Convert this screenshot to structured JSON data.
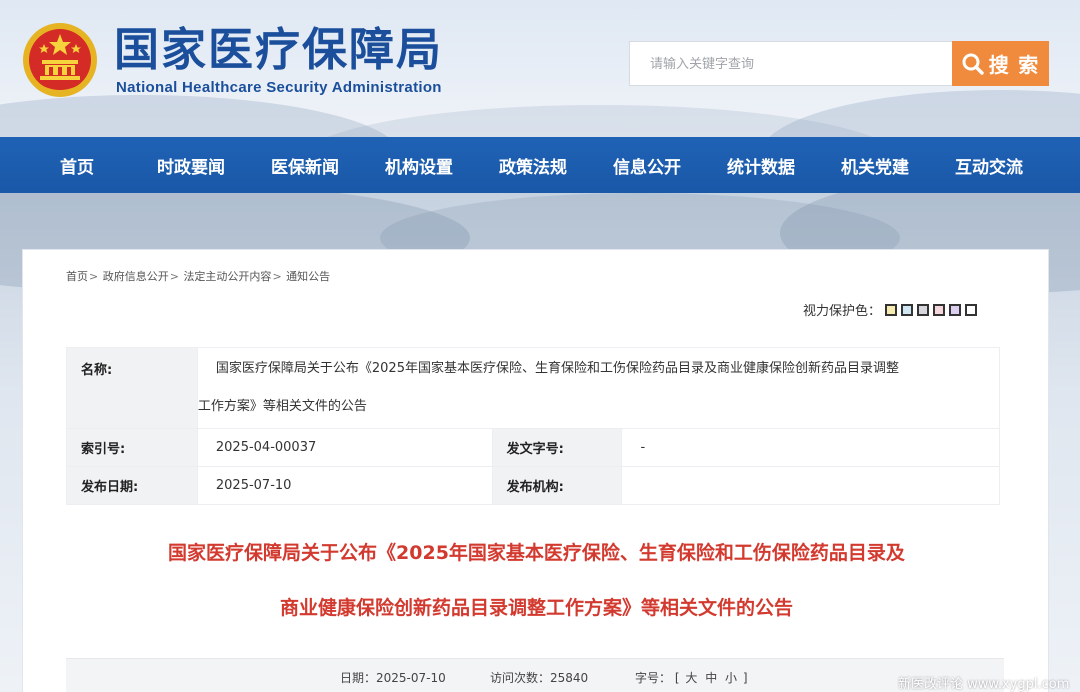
{
  "header": {
    "title_cn": "国家医疗保障局",
    "title_en": "National Healthcare Security Administration",
    "search_placeholder": "请输入关键字查询",
    "search_button": "搜 索"
  },
  "nav": {
    "items": [
      "首页",
      "时政要闻",
      "医保新闻",
      "机构设置",
      "政策法规",
      "信息公开",
      "统计数据",
      "机关党建",
      "互动交流"
    ]
  },
  "breadcrumb": {
    "items": [
      "首页",
      "政府信息公开",
      "法定主动公开内容",
      "通知公告"
    ],
    "separator": ">"
  },
  "vision": {
    "label": "视力保护色：",
    "swatches": [
      "#f6ecb0",
      "#cfe7f2",
      "#d6d6dc",
      "#f4d6dc",
      "#dccff0",
      "#ffffff"
    ]
  },
  "info": {
    "name_label": "名称:",
    "name_line1": "国家医疗保障局关于公布《2025年国家基本医疗保险、生育保险和工伤保险药品目录及商业健康保险创新药品目录调整",
    "name_line2": "工作方案》等相关文件的公告",
    "index_label": "索引号:",
    "index_value": "2025-04-00037",
    "docno_label": "发文字号:",
    "docno_value": "-",
    "date_label": "发布日期:",
    "date_value": "2025-07-10",
    "org_label": "发布机构:",
    "org_value": ""
  },
  "article": {
    "title_line1": "国家医疗保障局关于公布《2025年国家基本医疗保险、生育保险和工伤保险药品目录及",
    "title_line2": "商业健康保险创新药品目录调整工作方案》等相关文件的公告",
    "title_color": "#d33a2f"
  },
  "meta": {
    "date_label": "日期：",
    "date_value": "2025-07-10",
    "visits_label": "访问次数：",
    "visits_value": "25840",
    "fontsize_label": "字号：",
    "bracket_open": "[",
    "size_large": "大",
    "size_medium": "中",
    "size_small": "小",
    "bracket_close": "]"
  },
  "watermark": "新医改评论 www.xygpl.com",
  "colors": {
    "brand_blue": "#1b4f9c",
    "nav_blue": "#1f62b5",
    "search_orange": "#f08a3c"
  }
}
